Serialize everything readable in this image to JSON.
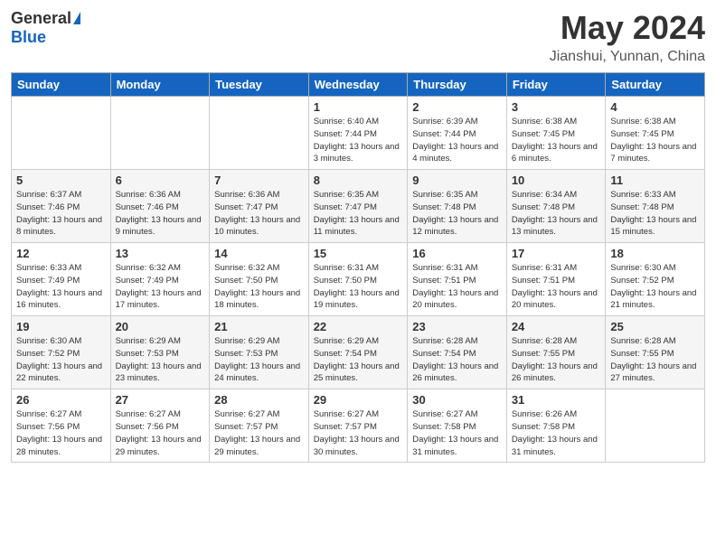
{
  "header": {
    "logo_general": "General",
    "logo_blue": "Blue",
    "title": "May 2024",
    "subtitle": "Jianshui, Yunnan, China"
  },
  "columns": [
    "Sunday",
    "Monday",
    "Tuesday",
    "Wednesday",
    "Thursday",
    "Friday",
    "Saturday"
  ],
  "weeks": [
    [
      {
        "day": "",
        "info": ""
      },
      {
        "day": "",
        "info": ""
      },
      {
        "day": "",
        "info": ""
      },
      {
        "day": "1",
        "info": "Sunrise: 6:40 AM\nSunset: 7:44 PM\nDaylight: 13 hours\nand 3 minutes."
      },
      {
        "day": "2",
        "info": "Sunrise: 6:39 AM\nSunset: 7:44 PM\nDaylight: 13 hours\nand 4 minutes."
      },
      {
        "day": "3",
        "info": "Sunrise: 6:38 AM\nSunset: 7:45 PM\nDaylight: 13 hours\nand 6 minutes."
      },
      {
        "day": "4",
        "info": "Sunrise: 6:38 AM\nSunset: 7:45 PM\nDaylight: 13 hours\nand 7 minutes."
      }
    ],
    [
      {
        "day": "5",
        "info": "Sunrise: 6:37 AM\nSunset: 7:46 PM\nDaylight: 13 hours\nand 8 minutes."
      },
      {
        "day": "6",
        "info": "Sunrise: 6:36 AM\nSunset: 7:46 PM\nDaylight: 13 hours\nand 9 minutes."
      },
      {
        "day": "7",
        "info": "Sunrise: 6:36 AM\nSunset: 7:47 PM\nDaylight: 13 hours\nand 10 minutes."
      },
      {
        "day": "8",
        "info": "Sunrise: 6:35 AM\nSunset: 7:47 PM\nDaylight: 13 hours\nand 11 minutes."
      },
      {
        "day": "9",
        "info": "Sunrise: 6:35 AM\nSunset: 7:48 PM\nDaylight: 13 hours\nand 12 minutes."
      },
      {
        "day": "10",
        "info": "Sunrise: 6:34 AM\nSunset: 7:48 PM\nDaylight: 13 hours\nand 13 minutes."
      },
      {
        "day": "11",
        "info": "Sunrise: 6:33 AM\nSunset: 7:48 PM\nDaylight: 13 hours\nand 15 minutes."
      }
    ],
    [
      {
        "day": "12",
        "info": "Sunrise: 6:33 AM\nSunset: 7:49 PM\nDaylight: 13 hours\nand 16 minutes."
      },
      {
        "day": "13",
        "info": "Sunrise: 6:32 AM\nSunset: 7:49 PM\nDaylight: 13 hours\nand 17 minutes."
      },
      {
        "day": "14",
        "info": "Sunrise: 6:32 AM\nSunset: 7:50 PM\nDaylight: 13 hours\nand 18 minutes."
      },
      {
        "day": "15",
        "info": "Sunrise: 6:31 AM\nSunset: 7:50 PM\nDaylight: 13 hours\nand 19 minutes."
      },
      {
        "day": "16",
        "info": "Sunrise: 6:31 AM\nSunset: 7:51 PM\nDaylight: 13 hours\nand 20 minutes."
      },
      {
        "day": "17",
        "info": "Sunrise: 6:31 AM\nSunset: 7:51 PM\nDaylight: 13 hours\nand 20 minutes."
      },
      {
        "day": "18",
        "info": "Sunrise: 6:30 AM\nSunset: 7:52 PM\nDaylight: 13 hours\nand 21 minutes."
      }
    ],
    [
      {
        "day": "19",
        "info": "Sunrise: 6:30 AM\nSunset: 7:52 PM\nDaylight: 13 hours\nand 22 minutes."
      },
      {
        "day": "20",
        "info": "Sunrise: 6:29 AM\nSunset: 7:53 PM\nDaylight: 13 hours\nand 23 minutes."
      },
      {
        "day": "21",
        "info": "Sunrise: 6:29 AM\nSunset: 7:53 PM\nDaylight: 13 hours\nand 24 minutes."
      },
      {
        "day": "22",
        "info": "Sunrise: 6:29 AM\nSunset: 7:54 PM\nDaylight: 13 hours\nand 25 minutes."
      },
      {
        "day": "23",
        "info": "Sunrise: 6:28 AM\nSunset: 7:54 PM\nDaylight: 13 hours\nand 26 minutes."
      },
      {
        "day": "24",
        "info": "Sunrise: 6:28 AM\nSunset: 7:55 PM\nDaylight: 13 hours\nand 26 minutes."
      },
      {
        "day": "25",
        "info": "Sunrise: 6:28 AM\nSunset: 7:55 PM\nDaylight: 13 hours\nand 27 minutes."
      }
    ],
    [
      {
        "day": "26",
        "info": "Sunrise: 6:27 AM\nSunset: 7:56 PM\nDaylight: 13 hours\nand 28 minutes."
      },
      {
        "day": "27",
        "info": "Sunrise: 6:27 AM\nSunset: 7:56 PM\nDaylight: 13 hours\nand 29 minutes."
      },
      {
        "day": "28",
        "info": "Sunrise: 6:27 AM\nSunset: 7:57 PM\nDaylight: 13 hours\nand 29 minutes."
      },
      {
        "day": "29",
        "info": "Sunrise: 6:27 AM\nSunset: 7:57 PM\nDaylight: 13 hours\nand 30 minutes."
      },
      {
        "day": "30",
        "info": "Sunrise: 6:27 AM\nSunset: 7:58 PM\nDaylight: 13 hours\nand 31 minutes."
      },
      {
        "day": "31",
        "info": "Sunrise: 6:26 AM\nSunset: 7:58 PM\nDaylight: 13 hours\nand 31 minutes."
      },
      {
        "day": "",
        "info": ""
      }
    ]
  ]
}
